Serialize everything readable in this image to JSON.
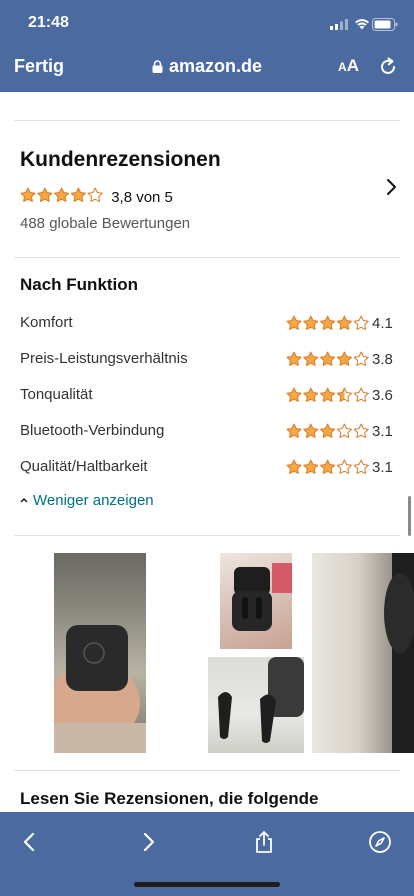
{
  "status_bar": {
    "time": "21:48"
  },
  "browser": {
    "done_label": "Fertig",
    "url": "amazon.de",
    "text_size_small": "A",
    "text_size_large": "A"
  },
  "reviews": {
    "title": "Kundenrezensionen",
    "rating": 3.8,
    "rating_text": "3,8 von 5",
    "global_count": "488 globale Bewertungen"
  },
  "by_feature": {
    "title": "Nach Funktion",
    "items": [
      {
        "label": "Komfort",
        "rating": 4.1,
        "value": "4.1"
      },
      {
        "label": "Preis-Leistungsverhältnis",
        "rating": 3.8,
        "value": "3.8"
      },
      {
        "label": "Tonqualität",
        "rating": 3.6,
        "value": "3.6"
      },
      {
        "label": "Bluetooth-Verbindung",
        "rating": 3.1,
        "value": "3.1"
      },
      {
        "label": "Qualität/Haltbarkeit",
        "rating": 3.1,
        "value": "3.1"
      }
    ],
    "show_less_label": "Weniger anzeigen"
  },
  "read_reviews_title": "Lesen Sie Rezensionen, die folgende",
  "colors": {
    "bar": "#4a6aa0",
    "star_fill": "#f3a847",
    "star_stroke": "#de7921",
    "link": "#007185"
  }
}
